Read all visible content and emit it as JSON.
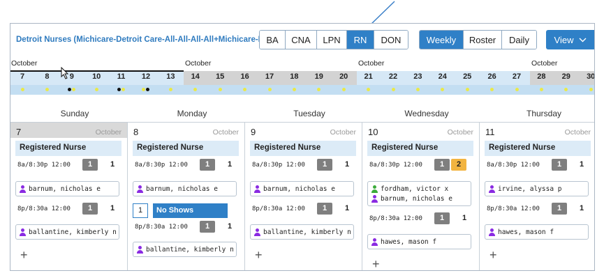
{
  "toolbar": {
    "title": "Detroit Nurses (Michicare-Detroit Care-All-All-All-All+Michicare-Ke...",
    "roles": [
      {
        "label": "BA",
        "active": false
      },
      {
        "label": "CNA",
        "active": false
      },
      {
        "label": "LPN",
        "active": false
      },
      {
        "label": "RN",
        "active": true
      },
      {
        "label": "DON",
        "active": false
      }
    ],
    "views": [
      {
        "label": "Weekly",
        "active": true
      },
      {
        "label": "Roster",
        "active": false
      },
      {
        "label": "Daily",
        "active": false
      }
    ],
    "view_menu": "View"
  },
  "timeline": {
    "months": [
      "October",
      "October",
      "October",
      "October"
    ],
    "days": [
      "7",
      "8",
      "9",
      "10",
      "11",
      "12",
      "13",
      "14",
      "15",
      "16",
      "17",
      "18",
      "19",
      "20",
      "21",
      "22",
      "23",
      "24",
      "25",
      "26",
      "27",
      "28",
      "29",
      "30"
    ]
  },
  "day_headers": [
    "Sunday",
    "Monday",
    "Tuesday",
    "Wednesday",
    "Thursday"
  ],
  "columns": [
    {
      "date": "7",
      "month": "October",
      "role": "Registered Nurse",
      "shifts": [
        {
          "time": "8a/8:30p 12:00",
          "filled": "1",
          "required": "1",
          "people": [
            {
              "name": "barnum, nicholas e",
              "color": "#8a2be2"
            }
          ]
        },
        {
          "time": "8p/8:30a 12:00",
          "filled": "1",
          "required": "1",
          "people": [
            {
              "name": "ballantine, kimberly n",
              "color": "#8a2be2"
            }
          ]
        }
      ]
    },
    {
      "date": "8",
      "month": "October",
      "role": "Registered Nurse",
      "no_shows": {
        "count": "1",
        "label": "No Shows"
      },
      "shifts": [
        {
          "time": "8a/8:30p 12:00",
          "filled": "1",
          "required": "1",
          "people": [
            {
              "name": "barnum, nicholas e",
              "color": "#8a2be2"
            }
          ]
        },
        {
          "time": "8p/8:30a 12:00",
          "filled": "1",
          "required": "1",
          "people": [
            {
              "name": "ballantine, kimberly n",
              "color": "#8a2be2"
            }
          ]
        }
      ]
    },
    {
      "date": "9",
      "month": "October",
      "role": "Registered Nurse",
      "shifts": [
        {
          "time": "8a/8:30p 12:00",
          "filled": "1",
          "required": "1",
          "people": [
            {
              "name": "barnum, nicholas e",
              "color": "#8a2be2"
            }
          ]
        },
        {
          "time": "8p/8:30a 12:00",
          "filled": "1",
          "required": "1",
          "people": [
            {
              "name": "ballantine, kimberly n",
              "color": "#8a2be2"
            }
          ]
        }
      ]
    },
    {
      "date": "10",
      "month": "October",
      "role": "Registered Nurse",
      "shifts": [
        {
          "time": "8a/8:30p 12:00",
          "filled": "1",
          "extra": "2",
          "people": [
            {
              "name": "fordham, victor x",
              "color": "#3cab3c"
            },
            {
              "name": "barnum, nicholas e",
              "color": "#8a2be2"
            }
          ]
        },
        {
          "time": "8p/8:30a 12:00",
          "filled": "1",
          "required": "1",
          "people": [
            {
              "name": "hawes, mason f",
              "color": "#8a2be2"
            }
          ]
        }
      ]
    },
    {
      "date": "11",
      "month": "October",
      "role": "Registered Nurse",
      "shifts": [
        {
          "time": "8a/8:30p 12:00",
          "filled": "1",
          "required": "1",
          "people": [
            {
              "name": "irvine, alyssa p",
              "color": "#8a2be2"
            }
          ]
        },
        {
          "time": "8p/8:30a 12:00",
          "filled": "1",
          "required": "1",
          "people": [
            {
              "name": "hawes, mason f",
              "color": "#8a2be2"
            }
          ]
        }
      ]
    }
  ],
  "add_symbol": "+",
  "colors": {
    "accent": "#2f80c7",
    "title": "#2f7bbf",
    "count_gray": "#7f7f7f",
    "count_orange": "#f2b440"
  }
}
